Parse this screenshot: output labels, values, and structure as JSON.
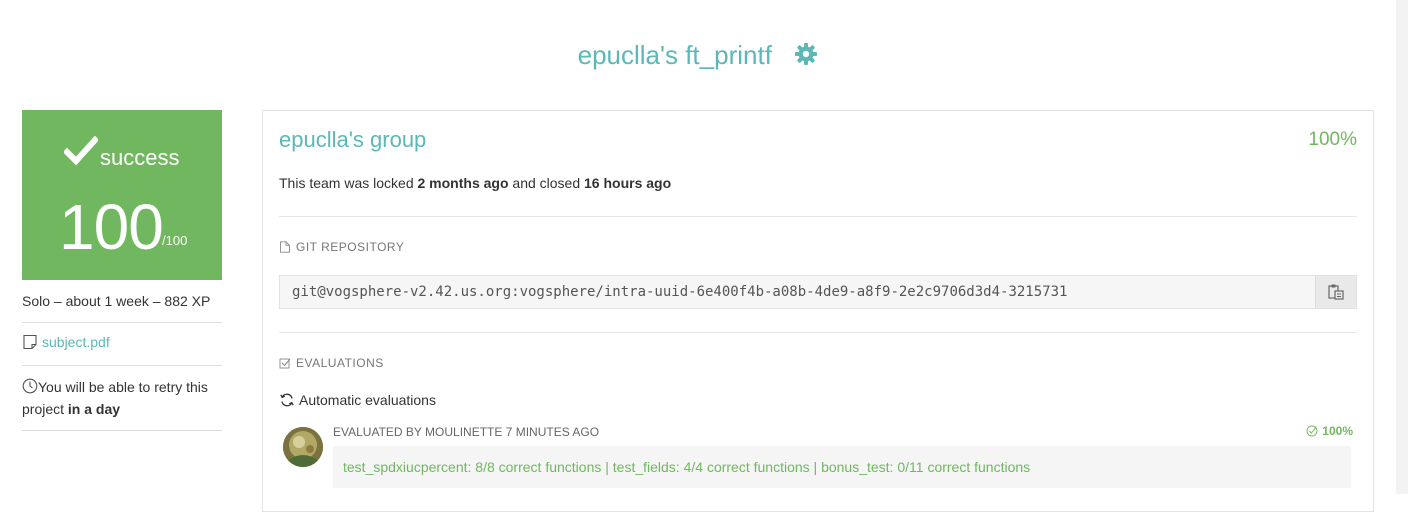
{
  "page": {
    "title": "epuclla's ft_printf"
  },
  "status": {
    "label": "success",
    "score": "100",
    "score_max": "/100"
  },
  "sidebar": {
    "meta": "Solo – about 1 week – 882 XP",
    "subject_link": "subject.pdf",
    "retry_prefix": "You will be able to retry this project ",
    "retry_when": "in a day"
  },
  "team": {
    "name": "epuclla's group",
    "percent": "100%",
    "lock_prefix": "This team was locked ",
    "locked_ago": "2 months ago",
    "lock_middle": " and closed ",
    "closed_ago": "16 hours ago"
  },
  "git": {
    "section_label": "GIT REPOSITORY",
    "url": "git@vogsphere-v2.42.us.org:vogsphere/intra-uuid-6e400f4b-a08b-4de9-a8f9-2e2c9706d3d4-3215731"
  },
  "evaluations": {
    "section_label": "EVALUATIONS",
    "automatic_label": "Automatic evaluations",
    "items": [
      {
        "evaluator_line": "EVALUATED BY MOULINETTE 7 MINUTES AGO",
        "percent": "100%",
        "result": "test_spdxiucpercent: 8/8 correct functions | test_fields: 4/4 correct functions | bonus_test: 0/11 correct functions"
      }
    ]
  },
  "colors": {
    "accent": "#5bb8b6",
    "success": "#71b760"
  },
  "icons": {
    "title": "gear-icon",
    "status": "checkmark-icon",
    "subject": "document-icon",
    "retry": "clock-icon",
    "git": "file-icon",
    "evaluations": "checkbox-icon",
    "automatic": "refresh-icon",
    "copy": "clipboard-icon",
    "eval_percent": "check-circle-icon"
  }
}
